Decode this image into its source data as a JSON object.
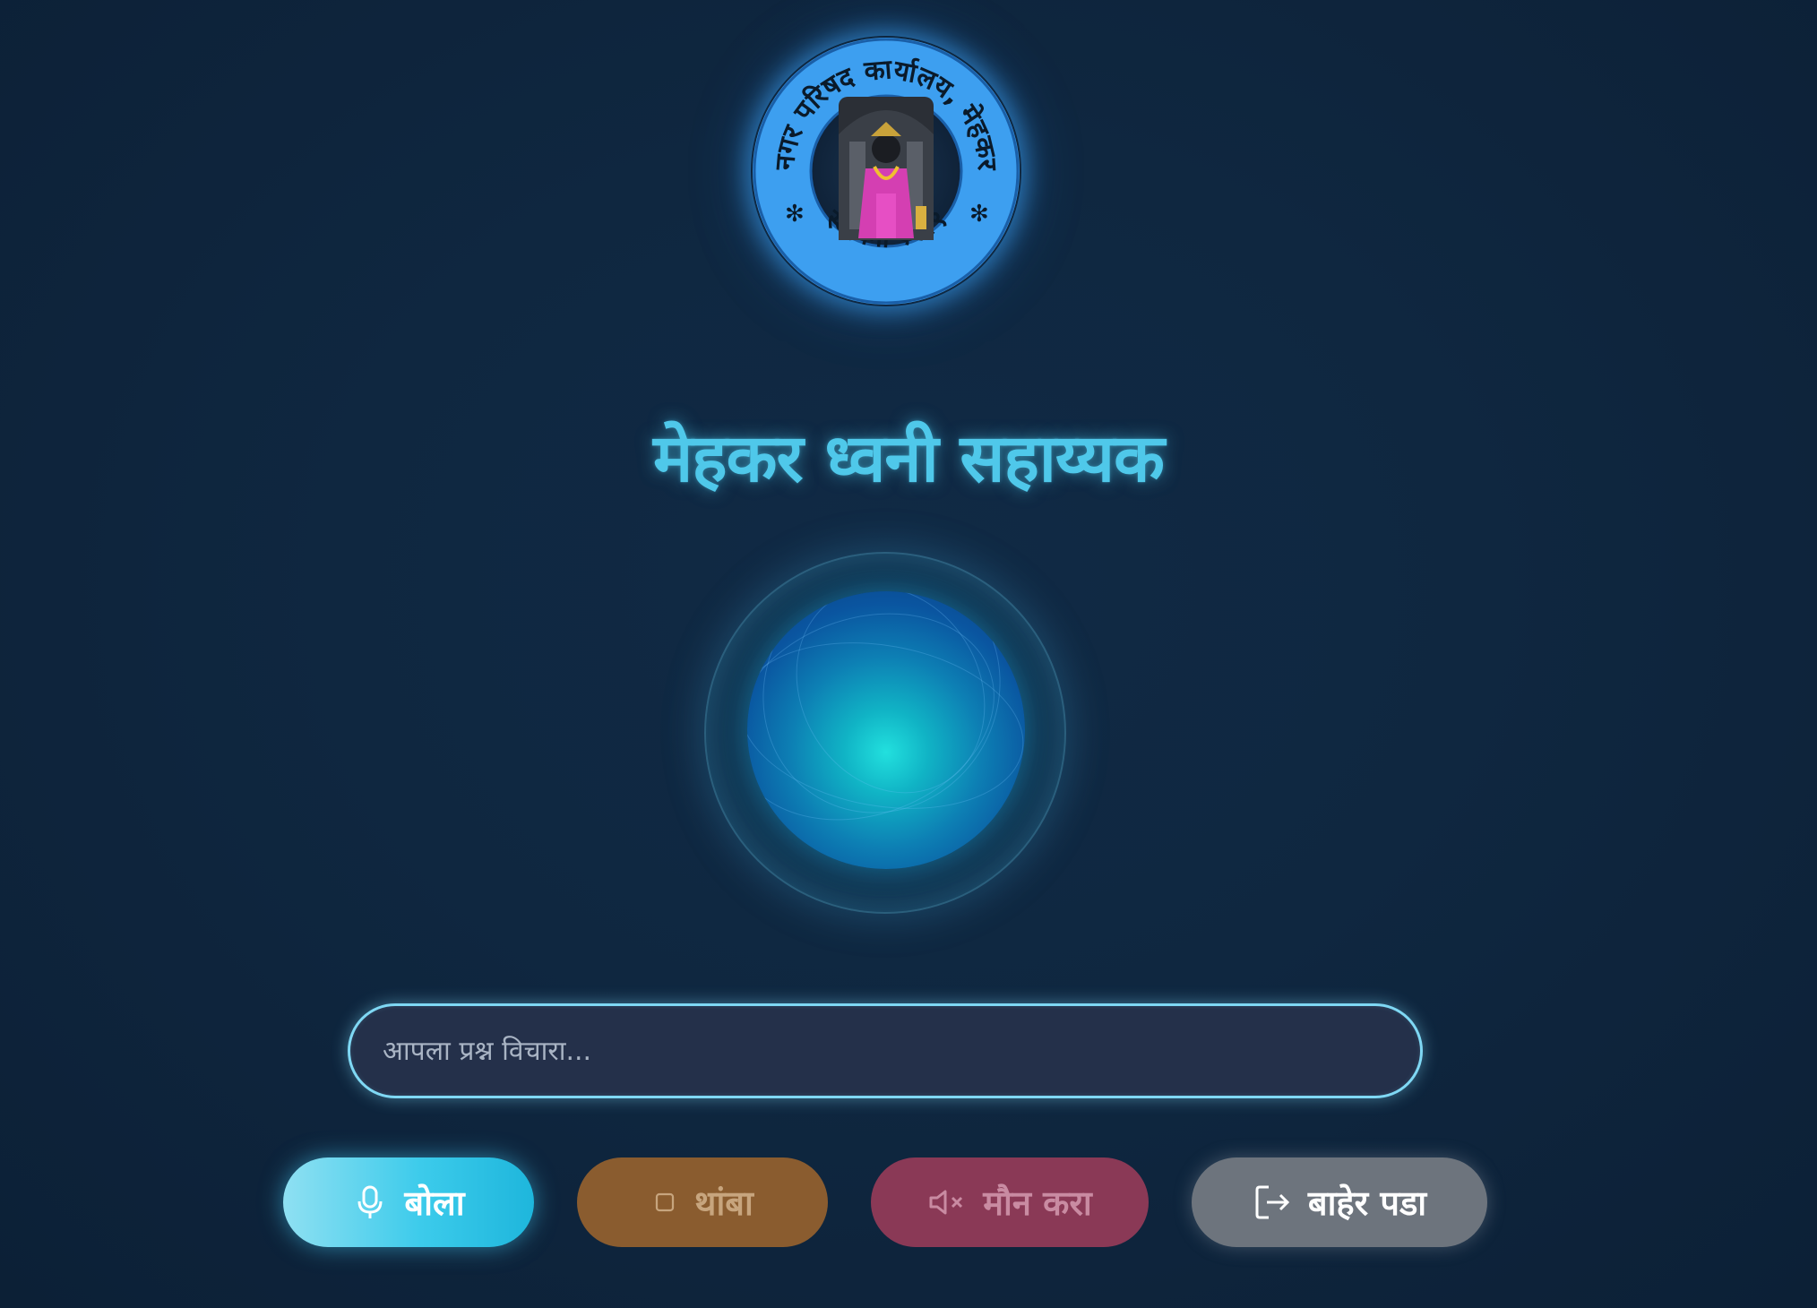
{
  "logo": {
    "ring_text_top": "नगर परिषद कार्यालय, मेहकर",
    "ring_text_bottom": "स्थापना १९२९",
    "ring_color": "#3d9ff0"
  },
  "title": "मेहकर ध्वनी सहाय्यक",
  "query": {
    "placeholder": "आपला प्रश्न विचारा..."
  },
  "buttons": {
    "speak": {
      "label": "बोला",
      "icon": "microphone-icon"
    },
    "stop": {
      "label": "थांबा",
      "icon": "square-stop-icon"
    },
    "mute": {
      "label": "मौन करा",
      "icon": "speaker-mute-icon"
    },
    "exit": {
      "label": "बाहेर पडा",
      "icon": "logout-icon"
    }
  },
  "colors": {
    "accent": "#4fc8ea",
    "speak": "#3ccbeb",
    "stop": "#8a5c2f",
    "mute": "#8a3956",
    "exit": "#6d747d"
  }
}
